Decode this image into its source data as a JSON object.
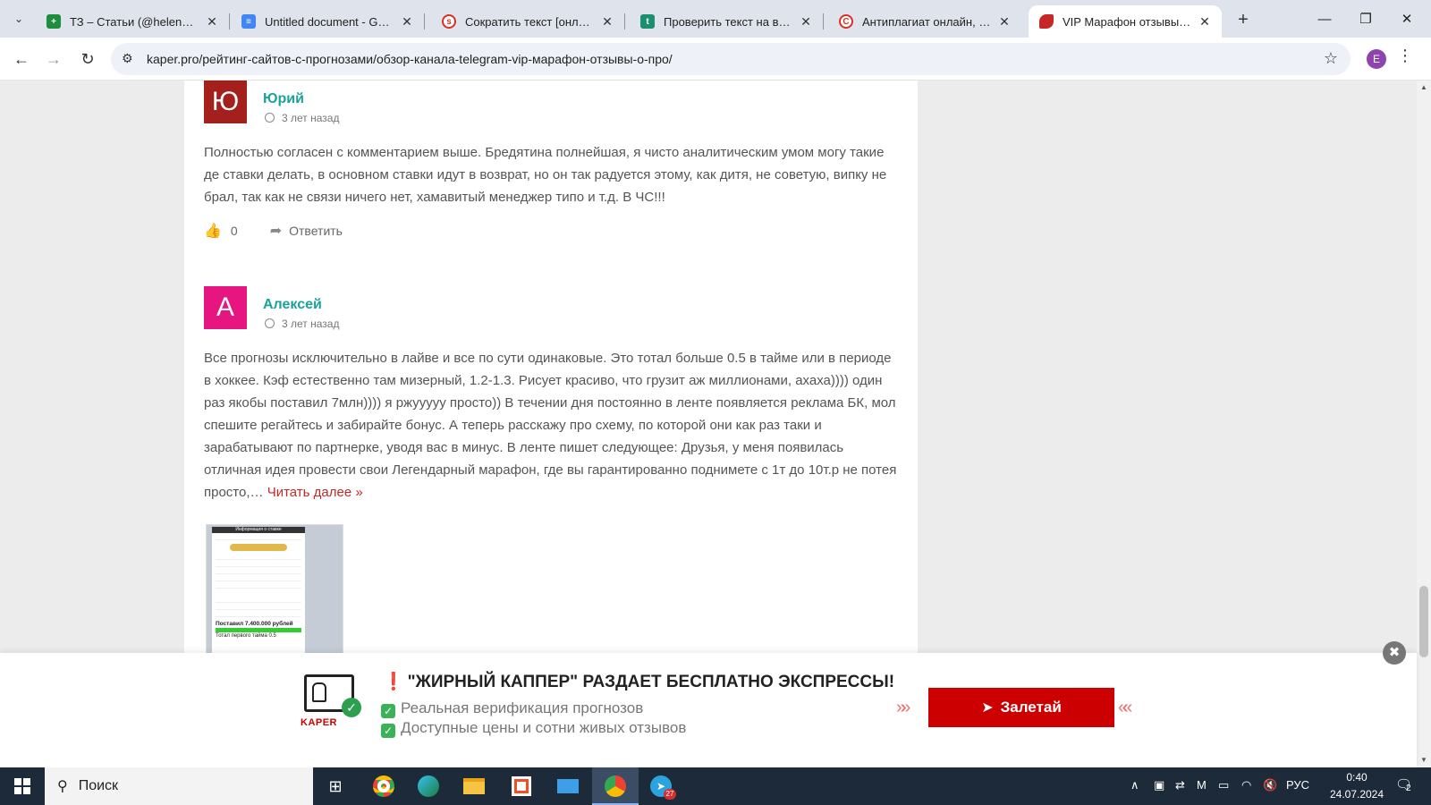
{
  "browser": {
    "tabs": [
      {
        "title": "ТЗ – Статьи (@helenslm) - Google Таблицы",
        "icon": "sheets-icon",
        "color": "#1e8e3e"
      },
      {
        "title": "Untitled document - Google Docs",
        "icon": "docs-icon",
        "color": "#4285f4"
      },
      {
        "title": "Сократить текст [онлайн] – бесплатно",
        "icon": "shorten-icon",
        "color": "#d93025"
      },
      {
        "title": "Проверить текст на вхождения",
        "icon": "check-text-icon",
        "color": "#1b8f6f"
      },
      {
        "title": "Антиплагиат онлайн, проверка",
        "icon": "antiplagiat-icon",
        "color": "#d93025"
      },
      {
        "title": "VIP Марафон отзывы – обзор",
        "icon": "kaper-icon",
        "color": "#c62828"
      }
    ],
    "url": "kaper.pro/рейтинг-сайтов-с-прогнозами/обзор-канала-telegram-vip-марафон-отзывы-о-про/",
    "profile_initial": "E"
  },
  "comments": [
    {
      "avatar_letter": "Ю",
      "avatar_color": "#a3201c",
      "author": "Юрий",
      "time": "3 лет назад",
      "text": "Полностью согласен с комментарием выше. Бредятина полнейшая, я чисто аналитическим умом могу такие де ставки делать, в основном ставки идут в возврат, но он так радуется этому, как дитя, не советую, випку не брал, так как не связи ничего нет, хамавитый менеджер типо и т.д. В ЧС!!!",
      "likes": "0",
      "reply_label": "Ответить"
    },
    {
      "avatar_letter": "А",
      "avatar_color": "#e6157f",
      "author": "Алексей",
      "time": "3 лет назад",
      "text": "Все прогнозы исключительно в лайве и все по сути одинаковые. Это тотал больше 0.5 в тайме или в периоде в хоккее. Кэф естественно там мизерный, 1.2-1.3. Рисует красиво, что грузит аж миллионами, ахаха)))) один раз якобы поставил 7млн)))) я ржууууу просто)) В течении дня постоянно в ленте появляется реклама БК, мол спешите регайтесь и забирайте бонус. А теперь расскажу про схему, по которой они как раз таки и зарабатывают по партнерке, уводя вас в минус. В ленте пишет следующее: Друзья, у меня появилась отличная идея провести свои Легендарный марафон, где вы гарантированно поднимете с 1т до 10т.р не потея просто,…",
      "read_more": "Читать далее »",
      "screenshot": {
        "header": "Информация о ставке",
        "bet_text": "Поставил 7.400.000 рублей",
        "sub_text": "Тотал первого тайма 0.5"
      }
    }
  ],
  "promo": {
    "logo_text": "KAPER",
    "title": "\"ЖИРНЫЙ КАППЕР\" РАЗДАЕТ БЕСПЛАТНО ЭКСПРЕССЫ!",
    "line1": "Реальная верификация прогнозов",
    "line2": "Доступные цены и сотни живых отзывов",
    "cta": "Залетай",
    "accent": "#cc0000"
  },
  "taskbar": {
    "search_label": "Поиск",
    "telegram_badge": "27",
    "lang": "РУС",
    "time": "0:40",
    "date": "24.07.2024",
    "notifications": "2"
  }
}
